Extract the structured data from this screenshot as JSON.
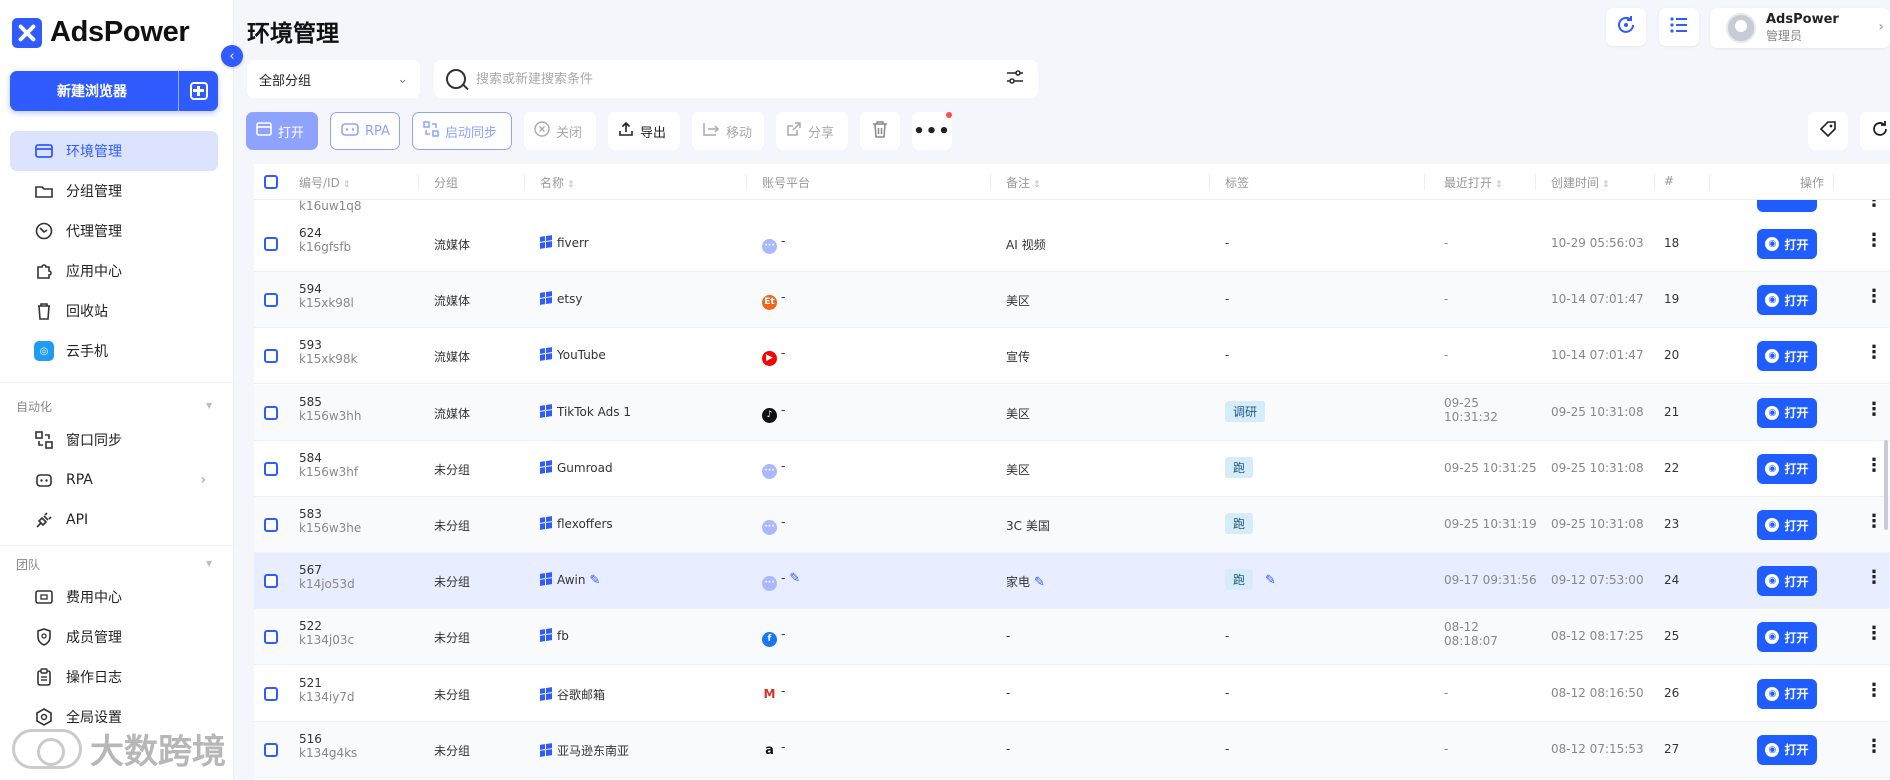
{
  "brand": {
    "name": "AdsPower"
  },
  "sidebar": {
    "new_browser_label": "新建浏览器",
    "items": [
      {
        "label": "环境管理",
        "icon": "browser-window-icon",
        "active": true
      },
      {
        "label": "分组管理",
        "icon": "folder-icon"
      },
      {
        "label": "代理管理",
        "icon": "proxy-globe-icon"
      },
      {
        "label": "应用中心",
        "icon": "puzzle-icon"
      },
      {
        "label": "回收站",
        "icon": "trash-icon"
      },
      {
        "label": "云手机",
        "icon": "cloud-phone-icon"
      }
    ],
    "automation_label": "自动化",
    "automation_items": [
      {
        "label": "窗口同步",
        "icon": "sync-windows-icon"
      },
      {
        "label": "RPA",
        "icon": "robot-icon"
      },
      {
        "label": "API",
        "icon": "plug-icon"
      }
    ],
    "team_label": "团队",
    "team_items": [
      {
        "label": "费用中心",
        "icon": "billing-icon"
      },
      {
        "label": "成员管理",
        "icon": "shield-user-icon"
      },
      {
        "label": "操作日志",
        "icon": "clipboard-icon"
      },
      {
        "label": "全局设置",
        "icon": "settings-icon"
      }
    ]
  },
  "watermark": {
    "text": "大数跨境"
  },
  "header": {
    "title": "环境管理",
    "user_name": "AdsPower",
    "user_role": "管理员"
  },
  "filters": {
    "group_value": "全部分组",
    "search_placeholder": "搜索或新建搜索条件"
  },
  "toolbar": {
    "open": "打开",
    "rpa": "RPA",
    "sync": "启动同步",
    "close": "关闭",
    "export": "导出",
    "move": "移动",
    "share": "分享"
  },
  "table": {
    "columns": {
      "id": "编号/ID",
      "group": "分组",
      "name": "名称",
      "platform": "账号平台",
      "remark": "备注",
      "tags": "标签",
      "last_open": "最近打开",
      "created": "创建时间",
      "seq": "#",
      "actions": "操作"
    },
    "partial_row": {
      "id": "k16uw1q8"
    },
    "open_label": "打开",
    "rows": [
      {
        "num": "624",
        "id": "k16gfsfb",
        "group": "流媒体",
        "name": "fiverr",
        "platform": "other",
        "platform_text": "-",
        "remark": "AI 视频",
        "tag": "",
        "tag_text": "-",
        "last_open": "-",
        "last_open2": "",
        "created": "10-29 05:56:03",
        "seq": "18"
      },
      {
        "num": "594",
        "id": "k15xk98l",
        "group": "流媒体",
        "name": "etsy",
        "platform": "etsy",
        "platform_text": "-",
        "remark": "美区",
        "tag": "",
        "tag_text": "-",
        "last_open": "-",
        "last_open2": "",
        "created": "10-14 07:01:47",
        "seq": "19"
      },
      {
        "num": "593",
        "id": "k15xk98k",
        "group": "流媒体",
        "name": "YouTube",
        "platform": "youtube",
        "platform_text": "-",
        "remark": "宣传",
        "tag": "",
        "tag_text": "-",
        "last_open": "-",
        "last_open2": "",
        "created": "10-14 07:01:47",
        "seq": "20"
      },
      {
        "num": "585",
        "id": "k156w3hh",
        "group": "流媒体",
        "name": "TikTok Ads 1",
        "platform": "tiktok",
        "platform_text": "-",
        "remark": "美区",
        "tag": "调研",
        "tag_text": "",
        "last_open": "09-25",
        "last_open2": "10:31:32",
        "created": "09-25 10:31:08",
        "seq": "21"
      },
      {
        "num": "584",
        "id": "k156w3hf",
        "group": "未分组",
        "name": "Gumroad",
        "platform": "other",
        "platform_text": "-",
        "remark": "美区",
        "tag": "跑",
        "tag_text": "",
        "last_open": "09-25 10:31:25",
        "last_open2": "",
        "created": "09-25 10:31:08",
        "seq": "22"
      },
      {
        "num": "583",
        "id": "k156w3he",
        "group": "未分组",
        "name": "flexoffers",
        "platform": "other",
        "platform_text": "-",
        "remark": "3C 美国",
        "tag": "跑",
        "tag_text": "",
        "last_open": "09-25 10:31:19",
        "last_open2": "",
        "created": "09-25 10:31:08",
        "seq": "23"
      },
      {
        "num": "567",
        "id": "k14jo53d",
        "group": "未分组",
        "name": "Awin",
        "platform": "other",
        "platform_text": "-",
        "remark": "家电",
        "tag": "跑",
        "tag_text": "",
        "last_open": "09-17 09:31:56",
        "last_open2": "",
        "created": "09-12 07:53:00",
        "seq": "24",
        "highlight": true
      },
      {
        "num": "522",
        "id": "k134j03c",
        "group": "未分组",
        "name": "fb",
        "platform": "facebook",
        "platform_text": "-",
        "remark": "-",
        "tag": "",
        "tag_text": "-",
        "last_open": "08-12",
        "last_open2": "08:18:07",
        "created": "08-12 08:17:25",
        "seq": "25"
      },
      {
        "num": "521",
        "id": "k134iy7d",
        "group": "未分组",
        "name": "谷歌邮箱",
        "platform": "gmail",
        "platform_text": "-",
        "remark": "-",
        "tag": "",
        "tag_text": "-",
        "last_open": "-",
        "last_open2": "",
        "created": "08-12 08:16:50",
        "seq": "26"
      },
      {
        "num": "516",
        "id": "k134g4ks",
        "group": "未分组",
        "name": "亚马逊东南亚",
        "platform": "amazon",
        "platform_text": "-",
        "remark": "-",
        "tag": "",
        "tag_text": "-",
        "last_open": "-",
        "last_open2": "",
        "created": "08-12 07:15:53",
        "seq": "27"
      }
    ]
  },
  "colors": {
    "primary": "#2f5bff",
    "active_nav_bg": "#dce3ff",
    "tag_bg": "#d6ecf8",
    "row_highlight": "#e8edff"
  }
}
